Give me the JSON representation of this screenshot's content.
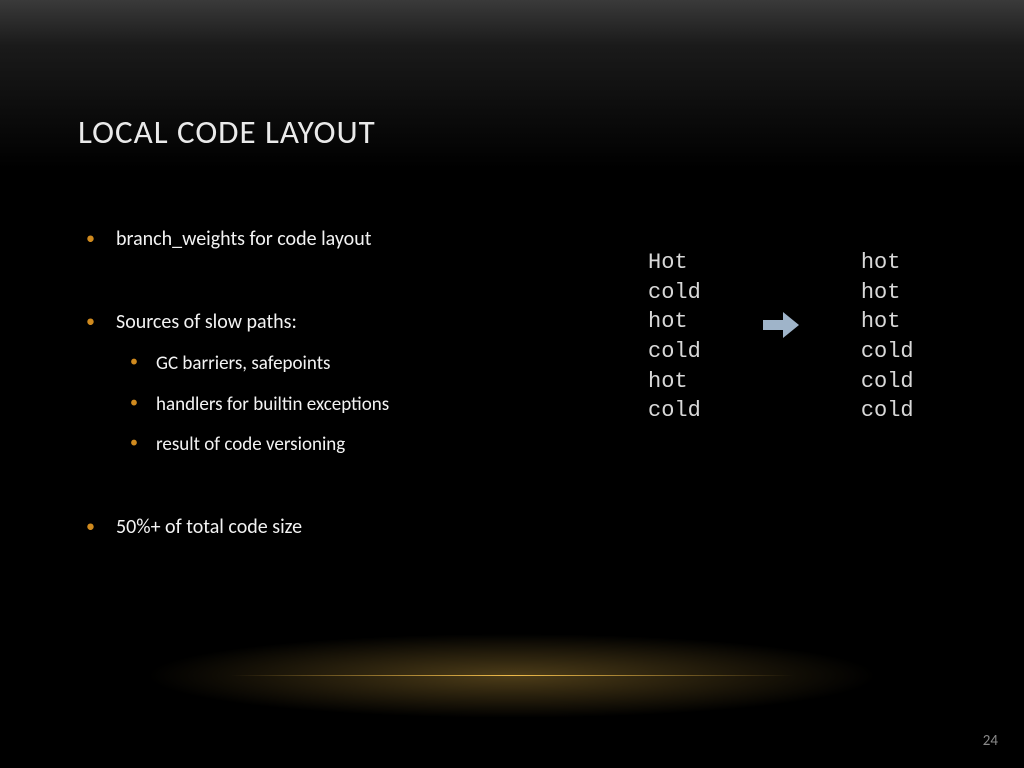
{
  "title": "LOCAL CODE LAYOUT",
  "bullets": {
    "b0": "branch_weights for code layout",
    "b1": "Sources of slow paths:",
    "b1s0": "GC barriers, safepoints",
    "b1s1": "handlers for builtin exceptions",
    "b1s2": "result of code versioning",
    "b2": "50%+ of total code size"
  },
  "diagram": {
    "left": [
      "Hot",
      "cold",
      "hot",
      "cold",
      "hot",
      "cold"
    ],
    "right": [
      "hot",
      "hot",
      "hot",
      "cold",
      "cold",
      "cold"
    ]
  },
  "page_number": "24"
}
